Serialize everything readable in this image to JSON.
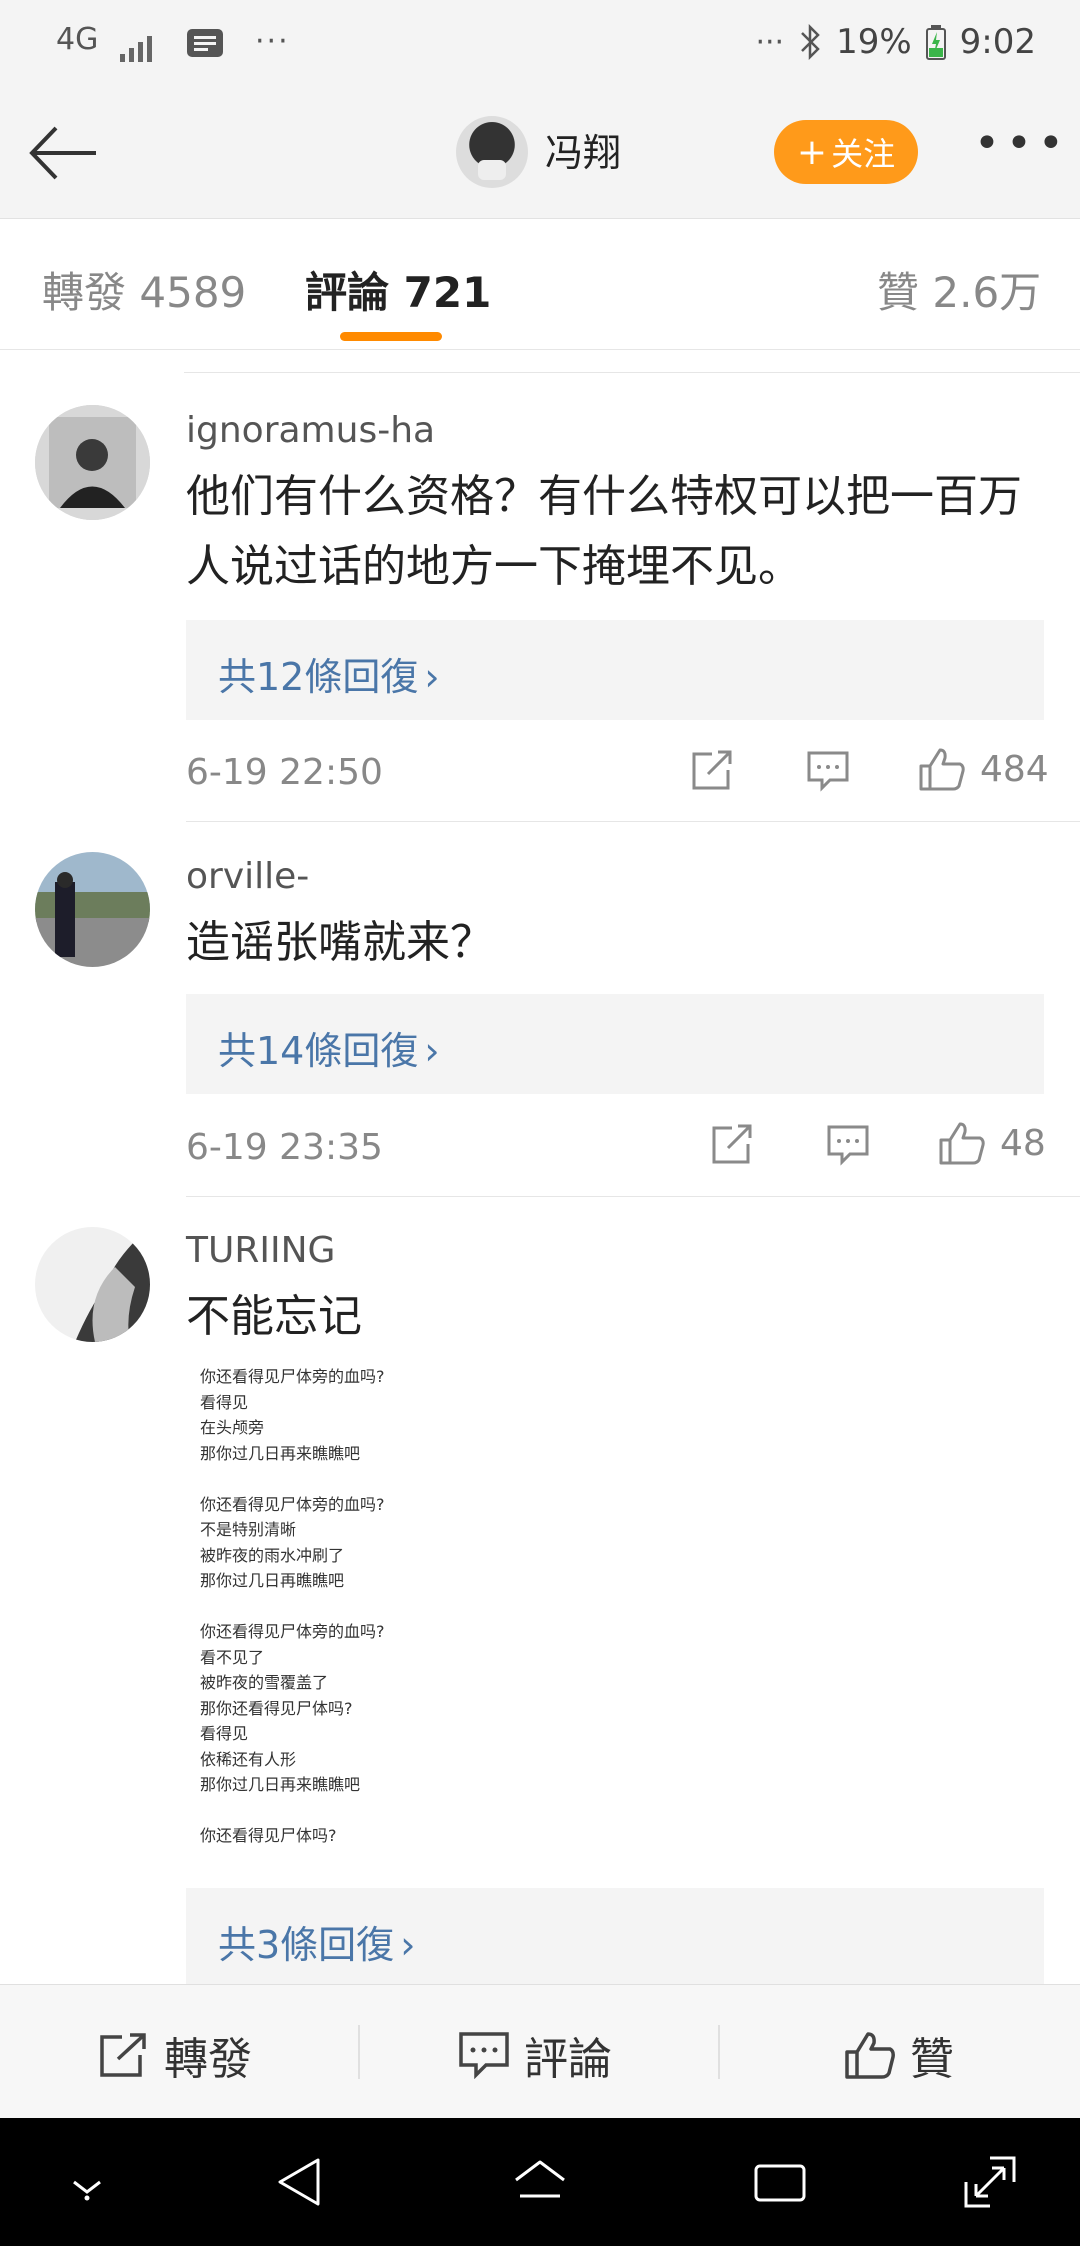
{
  "status_bar": {
    "network": "4G",
    "more_left": "···",
    "more_right": "···",
    "battery": "19%",
    "time": "9:02"
  },
  "header": {
    "username": "冯翔",
    "follow_label": "关注",
    "more_label": "•••"
  },
  "tabs": [
    {
      "label": "轉發",
      "count": "4589"
    },
    {
      "label": "評論",
      "count": "721"
    },
    {
      "label": "贊",
      "count": "2.6万"
    }
  ],
  "comments": [
    {
      "user": "ignoramus-ha",
      "text": "他们有什么资格？有什么特权可以把一百万人说过话的地方一下掩埋不见。",
      "replies": "共12條回復",
      "time": "6-19 22:50",
      "likes": "484"
    },
    {
      "user": "orville-",
      "text": "造谣张嘴就来？",
      "replies": "共14條回復",
      "time": "6-19 23:35",
      "likes": "48"
    },
    {
      "user": "TURIING",
      "text": "不能忘记",
      "image_text": "你还看得见尸体旁的血吗?\n看得见\n在头颅旁\n那你过几日再来瞧瞧吧\n\n你还看得见尸体旁的血吗?\n不是特别清晰\n被昨夜的雨水冲刷了\n那你过几日再瞧瞧吧\n\n你还看得见尸体旁的血吗?\n看不见了\n被昨夜的雪覆盖了\n那你还看得见尸体吗?\n看得见\n依稀还有人形\n那你过几日再来瞧瞧吧\n\n你还看得见尸体吗?",
      "replies": "共3條回復"
    }
  ],
  "bottom_bar": {
    "repost": "轉發",
    "comment": "評論",
    "like": "贊"
  },
  "reply_chevron": "›"
}
